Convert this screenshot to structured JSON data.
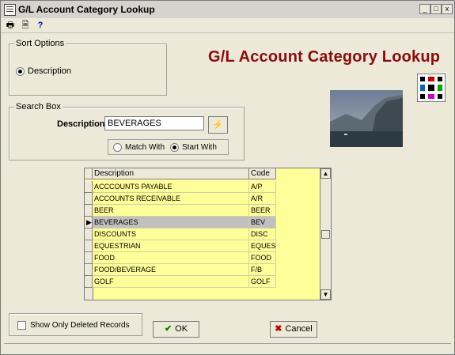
{
  "window": {
    "title": "G/L Account Category Lookup"
  },
  "titlebar_buttons": {
    "minimize": "_",
    "maximize": "□",
    "close": "x"
  },
  "toolbar": {
    "print": "🖶",
    "report": "🗎",
    "help": "?"
  },
  "header": {
    "big_title": "G/L Account Category Lookup"
  },
  "sort_options": {
    "label": "Sort Options",
    "options": [
      {
        "label": "Description",
        "selected": true
      }
    ]
  },
  "search_box": {
    "label": "Search Box",
    "field_label": "Description",
    "value": "BEVERAGES",
    "match_with": "Match With",
    "start_with": "Start With",
    "selected_mode": "start_with"
  },
  "grid": {
    "columns": [
      "Description",
      "Code"
    ],
    "rows": [
      {
        "description": "ACCCOUNTS PAYABLE",
        "code": "A/P",
        "selected": false
      },
      {
        "description": "ACCOUNTS RECEIVABLE",
        "code": "A/R",
        "selected": false
      },
      {
        "description": "BEER",
        "code": "BEER",
        "selected": false
      },
      {
        "description": "BEVERAGES",
        "code": "BEV",
        "selected": true
      },
      {
        "description": "DISCOUNTS",
        "code": "DISC",
        "selected": false
      },
      {
        "description": "EQUESTRIAN",
        "code": "EQUES",
        "selected": false
      },
      {
        "description": "FOOD",
        "code": "FOOD",
        "selected": false
      },
      {
        "description": "FOOD/BEVERAGE",
        "code": "F/B",
        "selected": false
      },
      {
        "description": "GOLF",
        "code": "GOLF",
        "selected": false
      }
    ]
  },
  "deleted_option": {
    "label": "Show Only Deleted Records",
    "checked": false
  },
  "buttons": {
    "ok": "OK",
    "cancel": "Cancel"
  },
  "colors": {
    "title_red": "#8b0c0c",
    "grid_yellow": "#ffff99",
    "selected_row": "#c0c0c0"
  }
}
